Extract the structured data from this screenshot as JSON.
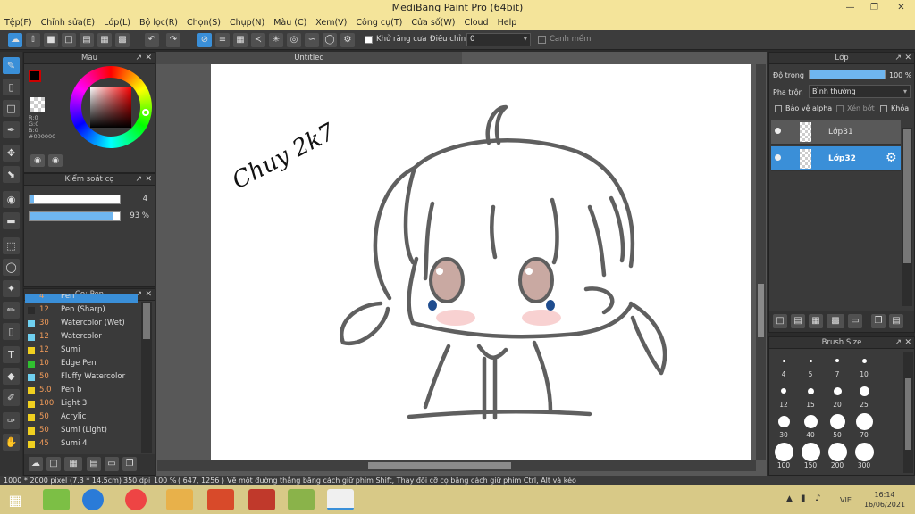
{
  "app": {
    "title": "MediBang Paint Pro (64bit)"
  },
  "menu": [
    "Tệp(F)",
    "Chỉnh sửa(E)",
    "Lớp(L)",
    "Bộ lọc(R)",
    "Chọn(S)",
    "Chụp(N)",
    "Màu (C)",
    "Xem(V)",
    "Công cụ(T)",
    "Cửa số(W)",
    "Cloud",
    "Help"
  ],
  "toolbar": {
    "antialias_label": "Khử răng cưa",
    "adjust_label": "Điều chỉnh",
    "adjust_value": "0",
    "canhmem_label": "Canh mềm"
  },
  "color_panel": {
    "title": "Màu",
    "r": "R:0",
    "g": "G:0",
    "b": "B:0",
    "hex": "#000000"
  },
  "brush_control": {
    "title": "Kiểm soát cọ",
    "size": "4",
    "opacity": "93 %",
    "opacity_fraction": 0.93
  },
  "brush_panel": {
    "title": "Cọ: Pen",
    "items": [
      {
        "size": "4",
        "name": "Pen",
        "color": "#3a8fd8"
      },
      {
        "size": "12",
        "name": "Pen (Sharp)",
        "color": "#2b2b2b"
      },
      {
        "size": "30",
        "name": "Watercolor (Wet)",
        "color": "#6fd0f0"
      },
      {
        "size": "12",
        "name": "Watercolor",
        "color": "#6fd0f0"
      },
      {
        "size": "12",
        "name": "Sumi",
        "color": "#f0d020"
      },
      {
        "size": "10",
        "name": "Edge Pen",
        "color": "#30c030"
      },
      {
        "size": "50",
        "name": "Fluffy Watercolor",
        "color": "#6fd0f0"
      },
      {
        "size": "5.0",
        "name": " Pen b",
        "color": "#f0d020"
      },
      {
        "size": "100",
        "name": "Light 3",
        "color": "#f0d020"
      },
      {
        "size": "50",
        "name": "Acrylic",
        "color": "#f0d020"
      },
      {
        "size": "50",
        "name": "Sumi (Light)",
        "color": "#f0d020"
      },
      {
        "size": "45",
        "name": "Sumi 4",
        "color": "#f0d020"
      }
    ]
  },
  "document": {
    "tab": "Untitled"
  },
  "layer_panel": {
    "title": "Lớp",
    "opacity_label": "Độ trong",
    "opacity_value": "100 %",
    "blend_label": "Pha trộn",
    "blend_value": "Bình thường",
    "protect_alpha": "Bảo vệ alpha",
    "clipping": "Xén bớt",
    "lock": "Khóa",
    "layers": [
      {
        "name": "Lớp31",
        "selected": false
      },
      {
        "name": "Lớp32",
        "selected": true
      }
    ]
  },
  "brush_size_panel": {
    "title": "Brush Size",
    "sizes": [
      "4",
      "5",
      "7",
      "10",
      "12",
      "15",
      "20",
      "25",
      "30",
      "40",
      "50",
      "70",
      "100",
      "150",
      "200",
      "300"
    ]
  },
  "status": {
    "size": "1000 * 2000 pixel",
    "cm": "(7.3 * 14.5cm)",
    "dpi": "350 dpi",
    "zoom": "100 %",
    "coords": "( 647, 1256 )",
    "hint": "Vẽ một đường thẳng bằng cách giữ phím Shift, Thay đổi cỡ cọ bằng cách giữ phím Ctrl, Alt và kéo"
  },
  "taskbar": {
    "time": "16:14",
    "date": "16/06/2021",
    "lang": "VIE"
  },
  "canvas": {
    "signature": "Chuy 2k7"
  }
}
